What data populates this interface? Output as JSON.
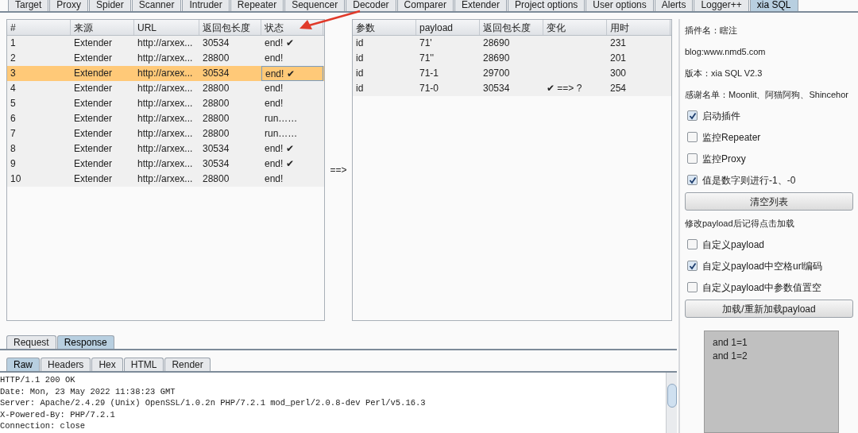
{
  "top_tabs": [
    {
      "label": "Target",
      "selected": false
    },
    {
      "label": "Proxy",
      "selected": false
    },
    {
      "label": "Spider",
      "selected": false
    },
    {
      "label": "Scanner",
      "selected": false
    },
    {
      "label": "Intruder",
      "selected": false
    },
    {
      "label": "Repeater",
      "selected": false
    },
    {
      "label": "Sequencer",
      "selected": false
    },
    {
      "label": "Decoder",
      "selected": false
    },
    {
      "label": "Comparer",
      "selected": false
    },
    {
      "label": "Extender",
      "selected": false
    },
    {
      "label": "Project options",
      "selected": false
    },
    {
      "label": "User options",
      "selected": false
    },
    {
      "label": "Alerts",
      "selected": false
    },
    {
      "label": "Logger++",
      "selected": false
    },
    {
      "label": "xia SQL",
      "selected": true
    }
  ],
  "request_table": {
    "columns": [
      "#",
      "来源",
      "URL",
      "返回包长度",
      "状态"
    ],
    "rows": [
      {
        "cells": [
          "1",
          "Extender",
          "http://arxex...",
          "30534",
          "end! ✔"
        ],
        "selected": false
      },
      {
        "cells": [
          "2",
          "Extender",
          "http://arxex...",
          "28800",
          "end!"
        ],
        "selected": false
      },
      {
        "cells": [
          "3",
          "Extender",
          "http://arxex...",
          "30534",
          "end! ✔"
        ],
        "selected": true
      },
      {
        "cells": [
          "4",
          "Extender",
          "http://arxex...",
          "28800",
          "end!"
        ],
        "selected": false
      },
      {
        "cells": [
          "5",
          "Extender",
          "http://arxex...",
          "28800",
          "end!"
        ],
        "selected": false
      },
      {
        "cells": [
          "6",
          "Extender",
          "http://arxex...",
          "28800",
          "run……"
        ],
        "selected": false
      },
      {
        "cells": [
          "7",
          "Extender",
          "http://arxex...",
          "28800",
          "run……"
        ],
        "selected": false
      },
      {
        "cells": [
          "8",
          "Extender",
          "http://arxex...",
          "30534",
          "end! ✔"
        ],
        "selected": false
      },
      {
        "cells": [
          "9",
          "Extender",
          "http://arxex...",
          "30534",
          "end! ✔"
        ],
        "selected": false
      },
      {
        "cells": [
          "10",
          "Extender",
          "http://arxex...",
          "28800",
          "end!"
        ],
        "selected": false
      }
    ]
  },
  "pointer": "==>",
  "payload_table": {
    "columns": [
      "参数",
      "payload",
      "返回包长度",
      "变化",
      "用时"
    ],
    "rows": [
      {
        "cells": [
          "id",
          "71'",
          "28690",
          "",
          "231"
        ]
      },
      {
        "cells": [
          "id",
          "71''",
          "28690",
          "",
          "201"
        ]
      },
      {
        "cells": [
          "id",
          "71-1",
          "29700",
          "",
          "300"
        ]
      },
      {
        "cells": [
          "id",
          "71-0",
          "30534",
          "✔ ==> ?",
          "254"
        ]
      }
    ]
  },
  "message_tabs": [
    {
      "label": "Request",
      "selected": false
    },
    {
      "label": "Response",
      "selected": true
    }
  ],
  "view_tabs": [
    {
      "label": "Raw",
      "selected": true
    },
    {
      "label": "Headers",
      "selected": false
    },
    {
      "label": "Hex",
      "selected": false
    },
    {
      "label": "HTML",
      "selected": false
    },
    {
      "label": "Render",
      "selected": false
    }
  ],
  "response_lines": [
    "HTTP/1.1 200 OK",
    "Date: Mon, 23 May 2022 11:38:23 GMT",
    "Server: Apache/2.4.29 (Unix) OpenSSL/1.0.2n PHP/7.2.1 mod_perl/2.0.8-dev Perl/v5.16.3",
    "X-Powered-By: PHP/7.2.1",
    "Connection: close"
  ],
  "settings": [
    {
      "kind": "text",
      "label": "插件名：瞎注"
    },
    {
      "kind": "text",
      "label": "blog:www.nmd5.com"
    },
    {
      "kind": "text",
      "label": "版本：xia SQL V2.3"
    },
    {
      "kind": "text",
      "label": "感谢名单：Moonlit、阿猫阿狗、Shincehor"
    },
    {
      "kind": "checkbox",
      "label": "启动插件",
      "checked": true
    },
    {
      "kind": "checkbox",
      "label": "监控Repeater",
      "checked": false
    },
    {
      "kind": "checkbox",
      "label": "监控Proxy",
      "checked": false
    },
    {
      "kind": "checkbox",
      "label": "值是数字则进行-1、-0",
      "checked": true
    },
    {
      "kind": "button",
      "label": "清空列表"
    },
    {
      "kind": "text",
      "label": "修改payload后记得点击加载"
    },
    {
      "kind": "checkbox",
      "label": "自定义payload",
      "checked": false
    },
    {
      "kind": "checkbox",
      "label": "自定义payload中空格url编码",
      "checked": true
    },
    {
      "kind": "checkbox",
      "label": "自定义payload中参数值置空",
      "checked": false
    },
    {
      "kind": "button",
      "label": "加载/重新加载payload"
    }
  ],
  "payload_list": [
    "and 1=1",
    "and 1=2"
  ]
}
